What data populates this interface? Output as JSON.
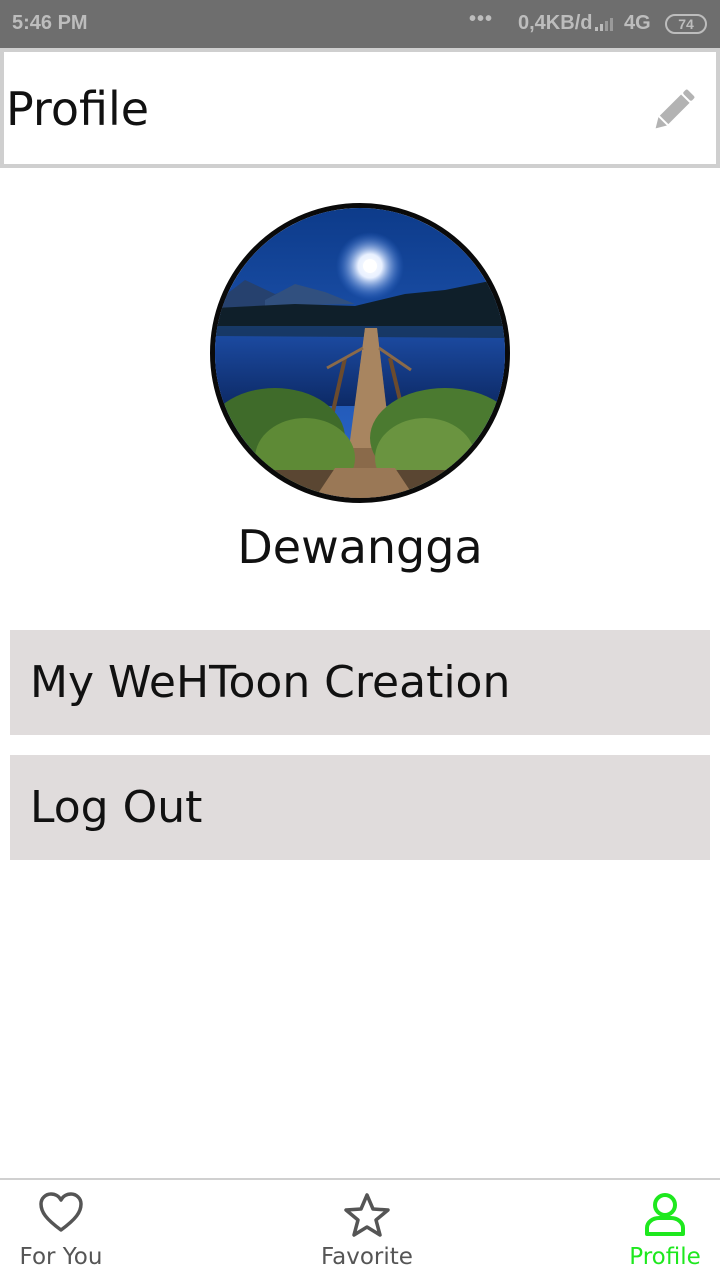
{
  "status_bar": {
    "time": "5:46 PM",
    "dots": "•••",
    "speed": "0,4KB/d",
    "network": "4G",
    "battery": "74"
  },
  "header": {
    "title": "Profile",
    "edit_icon": "pencil-icon"
  },
  "profile": {
    "username": "Dewangga"
  },
  "menu": {
    "items": [
      {
        "label": "My WeHToon Creation"
      },
      {
        "label": "Log Out"
      }
    ]
  },
  "bottom_nav": {
    "items": [
      {
        "label": "For You",
        "icon": "heart-icon"
      },
      {
        "label": "Favorite",
        "icon": "star-icon"
      },
      {
        "label": "Profile",
        "icon": "person-icon",
        "active": true
      }
    ],
    "active_color": "#1ee81e"
  },
  "colors": {
    "status_bar_bg": "#6e6e6e",
    "menu_item_bg": "#e0dcdc",
    "accent": "#1ee81e"
  }
}
